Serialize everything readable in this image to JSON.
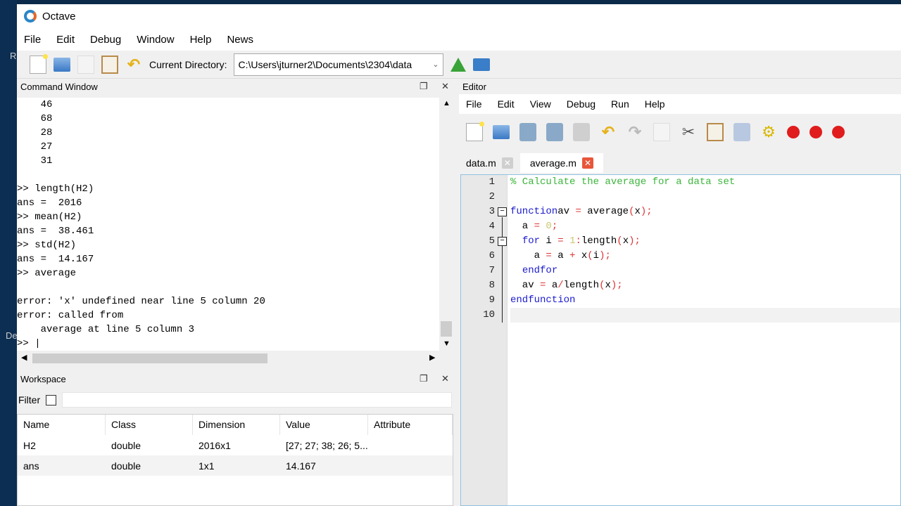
{
  "desktop": {
    "frag1": "R",
    "frag2": "De"
  },
  "app": {
    "title": "Octave"
  },
  "menu": [
    "File",
    "Edit",
    "Debug",
    "Window",
    "Help",
    "News"
  ],
  "toolbar": {
    "dir_label": "Current Directory:",
    "dir_value": "C:\\Users\\jturner2\\Documents\\2304\\data"
  },
  "command_window": {
    "title": "Command Window",
    "lines": [
      "    46",
      "    68",
      "    28",
      "    27",
      "    31",
      "",
      ">> length(H2)",
      "ans =  2016",
      ">> mean(H2)",
      "ans =  38.461",
      ">> std(H2)",
      "ans =  14.167",
      ">> average",
      "",
      "error: 'x' undefined near line 5 column 20",
      "error: called from",
      "    average at line 5 column 3",
      ">> |"
    ]
  },
  "workspace": {
    "title": "Workspace",
    "filter_label": "Filter",
    "columns": [
      "Name",
      "Class",
      "Dimension",
      "Value",
      "Attribute"
    ],
    "rows": [
      [
        "H2",
        "double",
        "2016x1",
        "[27; 27; 38; 26; 5...",
        ""
      ],
      [
        "ans",
        "double",
        "1x1",
        "14.167",
        ""
      ]
    ]
  },
  "editor": {
    "title": "Editor",
    "menu": [
      "File",
      "Edit",
      "View",
      "Debug",
      "Run",
      "Help"
    ],
    "tabs": [
      {
        "label": "data.m"
      },
      {
        "label": "average.m"
      }
    ],
    "lines": [
      [
        [
          "cm",
          "% Calculate the average for a data set"
        ]
      ],
      [],
      [
        [
          "kw",
          "function"
        ],
        [
          "",
          "av "
        ],
        [
          "op",
          "="
        ],
        [
          "",
          " average"
        ],
        [
          "op",
          "("
        ],
        [
          "",
          "x"
        ],
        [
          "op",
          ");"
        ]
      ],
      [
        [
          "",
          "  a "
        ],
        [
          "op",
          "="
        ],
        [
          "",
          " "
        ],
        [
          "num",
          "0"
        ],
        [
          "op",
          ";"
        ]
      ],
      [
        [
          "",
          "  "
        ],
        [
          "kw",
          "for"
        ],
        [
          "",
          " i "
        ],
        [
          "op",
          "="
        ],
        [
          "",
          " "
        ],
        [
          "num",
          "1"
        ],
        [
          "op",
          ":"
        ],
        [
          "",
          "length"
        ],
        [
          "op",
          "("
        ],
        [
          "",
          "x"
        ],
        [
          "op",
          ");"
        ]
      ],
      [
        [
          "",
          "    a "
        ],
        [
          "op",
          "="
        ],
        [
          "",
          " a "
        ],
        [
          "op",
          "+"
        ],
        [
          "",
          " x"
        ],
        [
          "op",
          "("
        ],
        [
          "",
          "i"
        ],
        [
          "op",
          ");"
        ]
      ],
      [
        [
          "",
          "  "
        ],
        [
          "kw",
          "endfor"
        ]
      ],
      [
        [
          "",
          "  av "
        ],
        [
          "op",
          "="
        ],
        [
          "",
          " a"
        ],
        [
          "op",
          "/"
        ],
        [
          "",
          "length"
        ],
        [
          "op",
          "("
        ],
        [
          "",
          "x"
        ],
        [
          "op",
          ");"
        ]
      ],
      [
        [
          "kw",
          "endfunction"
        ]
      ],
      []
    ]
  }
}
